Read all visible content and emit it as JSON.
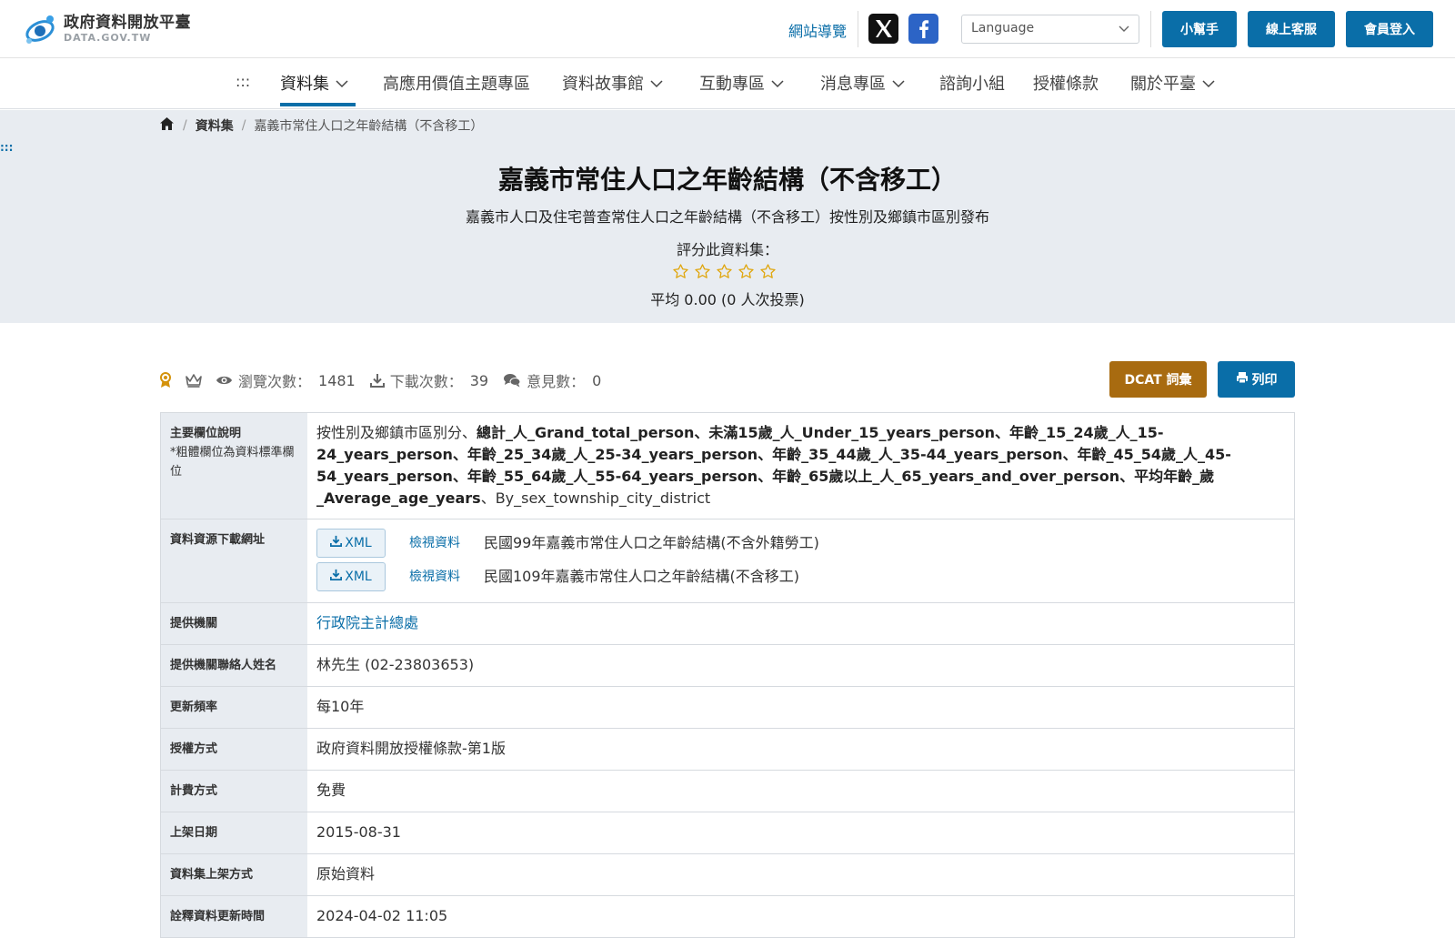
{
  "header": {
    "logo_cn": "政府資料開放平臺",
    "logo_en": "DATA.GOV.TW",
    "sitemap": "網站導覽",
    "language_placeholder": "Language",
    "buttons": {
      "helper": "小幫手",
      "service": "線上客服",
      "login": "會員登入"
    },
    "brand_color": "#0a6ea8"
  },
  "nav": {
    "dots": ":::",
    "items": [
      {
        "label": "資料集"
      },
      {
        "label": "高應用價值主題專區"
      },
      {
        "label": "資料故事館"
      },
      {
        "label": "互動專區"
      },
      {
        "label": "消息專區"
      },
      {
        "label": "諮詢小組"
      },
      {
        "label": "授權條款"
      },
      {
        "label": "關於平臺"
      }
    ]
  },
  "breadcrumb": {
    "items": [
      "資料集",
      "嘉義市常住人口之年齡結構（不含移工）"
    ]
  },
  "hero": {
    "dots": ":::",
    "title": "嘉義市常住人口之年齡結構（不含移工）",
    "subtitle": "嘉義市人口及住宅普查常住人口之年齡結構（不含移工）按性別及鄉鎮市區別發布",
    "rate_label": "評分此資料集：",
    "rating": 0,
    "rating_max": 5,
    "average": "平均 0.00 (0 人次投票)"
  },
  "stats": {
    "views_label": "瀏覽次數：",
    "views": "1481",
    "downloads_label": "下載次數：",
    "downloads": "39",
    "comments_label": "意見數：",
    "comments": "0"
  },
  "actions": {
    "dcat": "DCAT 詞彙",
    "print": "列印"
  },
  "details": {
    "fields_label": "主要欄位說明",
    "fields_note": "*粗體欄位為資料標準欄位",
    "fields_prefix": "按性別及鄉鎮市區別分、",
    "fields_bold": "總計_人_Grand_total_person、未滿15歲_人_Under_15_years_person、年齡_15_24歲_人_15-24_years_person、年齡_25_34歲_人_25-34_years_person、年齡_35_44歲_人_35-44_years_person、年齡_45_54歲_人_45-54_years_person、年齡_55_64歲_人_55-64_years_person、年齡_65歲以上_人_65_years_and_over_person、平均年齡_歲_Average_age_years",
    "fields_suffix": "、By_sex_township_city_district",
    "resources_label": "資料資源下載網址",
    "resources": [
      {
        "format": "XML",
        "view": "檢視資料",
        "name": "民國99年嘉義市常住人口之年齡結構(不含外籍勞工)"
      },
      {
        "format": "XML",
        "view": "檢視資料",
        "name": "民國109年嘉義市常住人口之年齡結構(不含移工)"
      }
    ],
    "rows": [
      {
        "label": "提供機關",
        "value": "行政院主計總處",
        "link": true
      },
      {
        "label": "提供機關聯絡人姓名",
        "value": "林先生 (02-23803653)"
      },
      {
        "label": "更新頻率",
        "value": "每10年"
      },
      {
        "label": "授權方式",
        "value": "政府資料開放授權條款-第1版"
      },
      {
        "label": "計費方式",
        "value": "免費"
      },
      {
        "label": "上架日期",
        "value": "2015-08-31"
      },
      {
        "label": "資料集上架方式",
        "value": "原始資料"
      },
      {
        "label": "詮釋資料更新時間",
        "value": "2024-04-02 11:05"
      }
    ]
  }
}
